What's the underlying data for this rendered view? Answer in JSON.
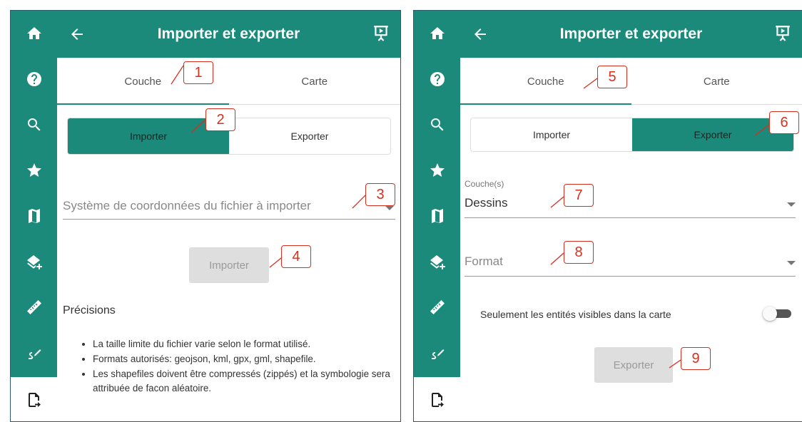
{
  "app": {
    "title": "Importer et exporter"
  },
  "tabs": {
    "couche": "Couche",
    "carte": "Carte"
  },
  "segment": {
    "importer": "Importer",
    "exporter": "Exporter"
  },
  "left": {
    "coord_placeholder": "Système de coordonnées du fichier à importer",
    "import_button": "Importer",
    "precisions_title": "Précisions",
    "precisions": [
      "La taille limite du fichier varie selon le format utilisé.",
      "Formats autorisés: geojson, kml, gpx, gml, shapefile.",
      "Les shapefiles doivent être compressés (zippés) et la symbologie sera attribuée de facon aléatoire."
    ]
  },
  "right": {
    "layers_label": "Couche(s)",
    "layers_value": "Dessins",
    "format_placeholder": "Format",
    "visible_only_label": "Seulement les entités visibles dans la carte",
    "visible_only_on": false,
    "export_button": "Exporter"
  },
  "rail_icons": [
    "home-icon",
    "help-icon",
    "search-icon",
    "star-icon",
    "map-icon",
    "add-layer-icon",
    "ruler-icon",
    "draw-icon",
    "file-export-icon"
  ],
  "callouts": [
    "1",
    "2",
    "3",
    "4",
    "5",
    "6",
    "7",
    "8",
    "9"
  ],
  "colors": {
    "primary": "#1b8a7b",
    "callout": "#d6301f",
    "disabled": "#dedede"
  }
}
